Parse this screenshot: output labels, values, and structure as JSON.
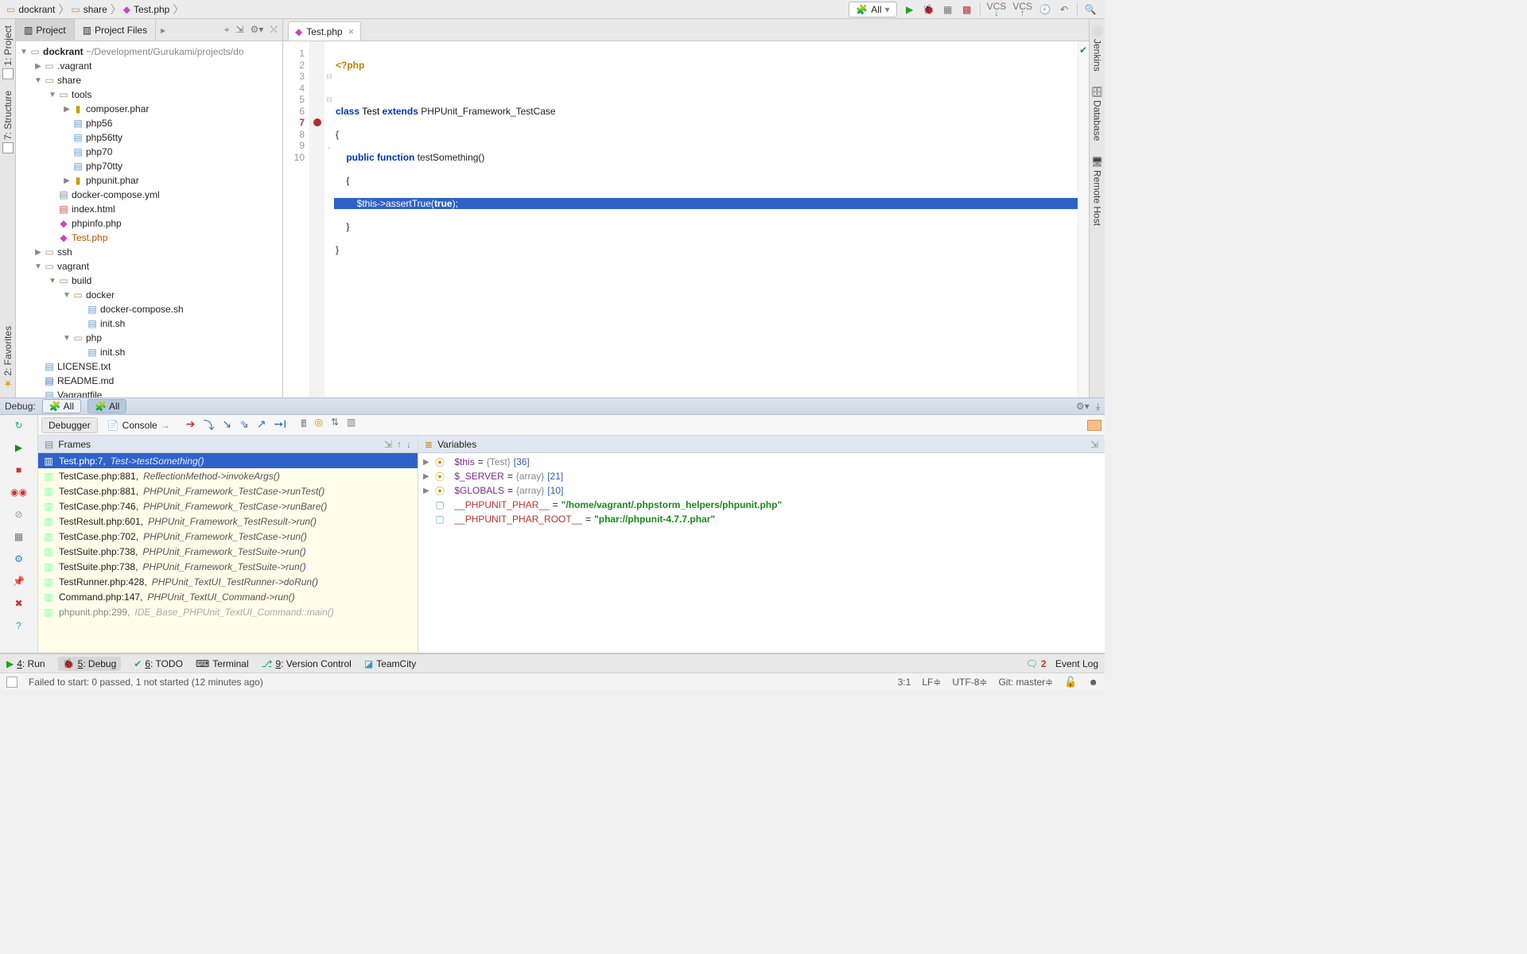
{
  "breadcrumb": {
    "root": "dockrant",
    "share": "share",
    "file": "Test.php"
  },
  "topbar": {
    "config_label": "All",
    "vcs_label": "VCS"
  },
  "left_dock": {
    "project": "1: Project",
    "structure": "7: Structure",
    "favorites": "2: Favorites"
  },
  "right_dock": {
    "jenkins": "Jenkins",
    "database": "Database",
    "remote": "Remote Host"
  },
  "project_tabs": {
    "project": "Project",
    "files": "Project Files"
  },
  "tree": {
    "root": "dockrant",
    "root_path": "~/Development/Gurukami/projects/do",
    "vagrant": ".vagrant",
    "share": "share",
    "tools": "tools",
    "composer": "composer.phar",
    "php56": "php56",
    "php56tty": "php56tty",
    "php70": "php70",
    "php70tty": "php70tty",
    "phpunit": "phpunit.phar",
    "compose": "docker-compose.yml",
    "index": "index.html",
    "phpinfo": "phpinfo.php",
    "test": "Test.php",
    "ssh": "ssh",
    "vagrantd": "vagrant",
    "build": "build",
    "docker": "docker",
    "dcsh": "docker-compose.sh",
    "initsh": "init.sh",
    "phpd": "php",
    "initsh2": "init.sh",
    "license": "LICENSE.txt",
    "readme": "README.md",
    "vagrantfile": "Vagrantfile"
  },
  "editor": {
    "tab": "Test.php",
    "lines": {
      "l1": "<?php",
      "l3a": "class",
      "l3b": "Test",
      "l3c": "extends",
      "l3d": "PHPUnit_Framework_TestCase",
      "l4": "{",
      "l5a": "public",
      "l5b": "function",
      "l5c": "testSomething()",
      "l6": "{",
      "l7a": "$this->assertTrue(",
      "l7b": "true",
      "l7c": ");",
      "l8": "}",
      "l9": "}"
    },
    "line_numbers": [
      "1",
      "2",
      "3",
      "4",
      "5",
      "6",
      "7",
      "8",
      "9",
      "10"
    ]
  },
  "debug": {
    "header": "Debug:",
    "all": "All",
    "debugger": "Debugger",
    "console": "Console",
    "frames_title": "Frames",
    "vars_title": "Variables"
  },
  "frames": [
    {
      "loc": "Test.php:7,",
      "meth": "Test->testSomething()",
      "sel": true
    },
    {
      "loc": "TestCase.php:881,",
      "meth": "ReflectionMethod->invokeArgs()"
    },
    {
      "loc": "TestCase.php:881,",
      "meth": "PHPUnit_Framework_TestCase->runTest()"
    },
    {
      "loc": "TestCase.php:746,",
      "meth": "PHPUnit_Framework_TestCase->runBare()"
    },
    {
      "loc": "TestResult.php:601,",
      "meth": "PHPUnit_Framework_TestResult->run()"
    },
    {
      "loc": "TestCase.php:702,",
      "meth": "PHPUnit_Framework_TestCase->run()"
    },
    {
      "loc": "TestSuite.php:738,",
      "meth": "PHPUnit_Framework_TestSuite->run()"
    },
    {
      "loc": "TestSuite.php:738,",
      "meth": "PHPUnit_Framework_TestSuite->run()"
    },
    {
      "loc": "TestRunner.php:428,",
      "meth": "PHPUnit_TextUI_TestRunner->doRun()"
    },
    {
      "loc": "Command.php:147,",
      "meth": "PHPUnit_TextUI_Command->run()"
    },
    {
      "loc": "phpunit.php:299,",
      "meth": "IDE_Base_PHPUnit_TextUI_Command::main()",
      "lib": true
    }
  ],
  "vars": {
    "this_name": "$this",
    "this_eq": " = ",
    "this_type": "{Test}",
    "this_size": " [36]",
    "server_name": "$_SERVER",
    "server_type": "{array}",
    "server_size": " [21]",
    "globals_name": "$GLOBALS",
    "globals_type": "{array}",
    "globals_size": " [10]",
    "phar_name": "__PHPUNIT_PHAR__",
    "phar_val": "\"/home/vagrant/.phpstorm_helpers/phpunit.php\"",
    "pharroot_name": "__PHPUNIT_PHAR_ROOT__",
    "pharroot_val": "\"phar://phpunit-4.7.7.phar\"",
    "eq": " = "
  },
  "bottom": {
    "run": "4: Run",
    "debug": "5: Debug",
    "todo": "6: TODO",
    "terminal": "Terminal",
    "vcs": "9: Version Control",
    "teamcity": "TeamCity",
    "eventlog": "Event Log",
    "eventcount": "2"
  },
  "status": {
    "msg": "Failed to start: 0 passed, 1 not started (12 minutes ago)",
    "pos": "3:1",
    "lf": "LF≑",
    "enc": "UTF-8≑",
    "git": "Git: master≑"
  }
}
